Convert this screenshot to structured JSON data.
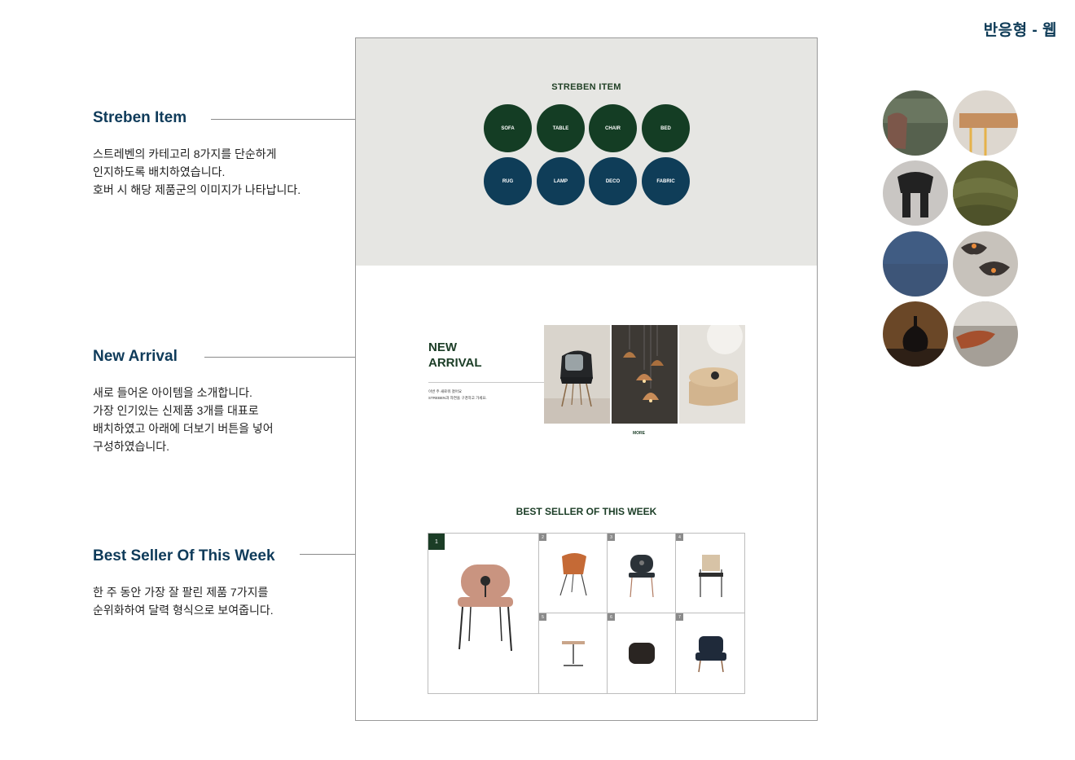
{
  "tag": "반응형 - 웹",
  "notes": {
    "items": {
      "title": "Streben Item",
      "line1": "스트레벤의 카테고리 8가지를 단순하게",
      "line2": "인지하도록 배치하였습니다.",
      "line3": "호버 시 해당 제품군의 이미지가 나타납니다."
    },
    "arrival": {
      "title": "New Arrival",
      "line1": "새로 들어온 아이템을 소개합니다.",
      "line2": "가장 인기있는 신제품 3개를 대표로",
      "line3": "배치하였고 아래에 더보기 버튼을 넣어",
      "line4": "구성하였습니다."
    },
    "best": {
      "title": "Best Seller Of This Week",
      "line1": "한 주 동안 가장 잘 팔린 제품 7가지를",
      "line2": "순위화하여 달력 형식으로 보여줍니다."
    }
  },
  "mockup": {
    "items_title": "STREBEN ITEM",
    "categories": [
      "SOFA",
      "TABLE",
      "CHAIR",
      "BED",
      "RUG",
      "LAMP",
      "DECO",
      "FABRIC"
    ],
    "arrival_line1": "NEW",
    "arrival_line2": "ARRIVAL",
    "arrival_copy1": "이번 주 새로워 졌어요",
    "arrival_copy2": "STREBEN과 자연을 구경하고 가세요.",
    "more": "MORE",
    "best_title": "BEST SELLER OF THIS WEEK",
    "ranks": [
      "1",
      "2",
      "3",
      "4",
      "5",
      "6",
      "7"
    ]
  },
  "colors": {
    "accent_navy": "#0f3b5a",
    "green": "#143d24",
    "blue": "#0f3d58",
    "section_bg": "#e6e6e3"
  },
  "swatches": [
    "sofa-swatch",
    "table-swatch",
    "chair-swatch",
    "fabric-swatch",
    "rug-swatch",
    "lamp-swatch",
    "deco-swatch",
    "bed-swatch"
  ]
}
